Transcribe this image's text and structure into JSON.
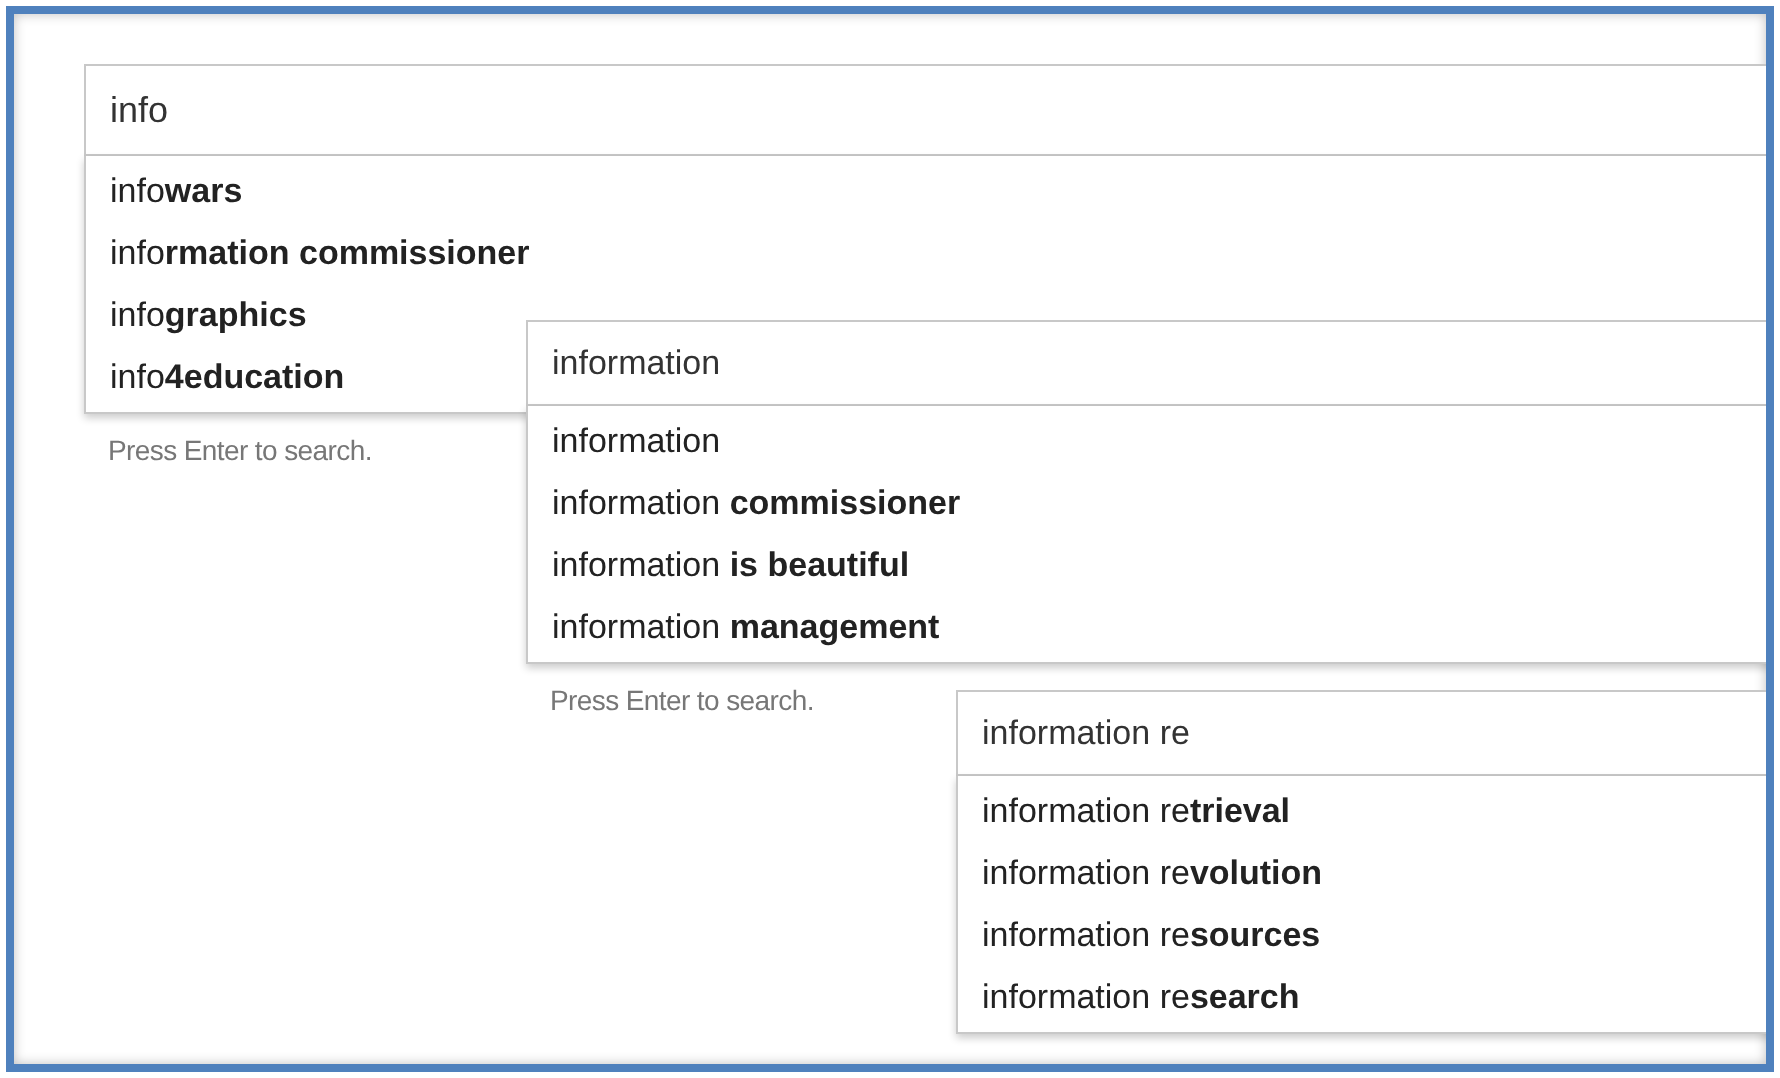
{
  "searches": [
    {
      "query": "info",
      "suggestions": [
        "info**wars**",
        "info**rmation commissioner**",
        "info**graphics**",
        "info**4education**"
      ],
      "hint": "Press Enter to search."
    },
    {
      "query": "information",
      "suggestions": [
        "information",
        "information **commissioner**",
        "information **is beautiful**",
        "information **management**"
      ],
      "hint": "Press Enter to search."
    },
    {
      "query": "information re",
      "suggestions": [
        "information re**trieval**",
        "information re**volution**",
        "information re**sources**",
        "information re**search**"
      ]
    }
  ]
}
